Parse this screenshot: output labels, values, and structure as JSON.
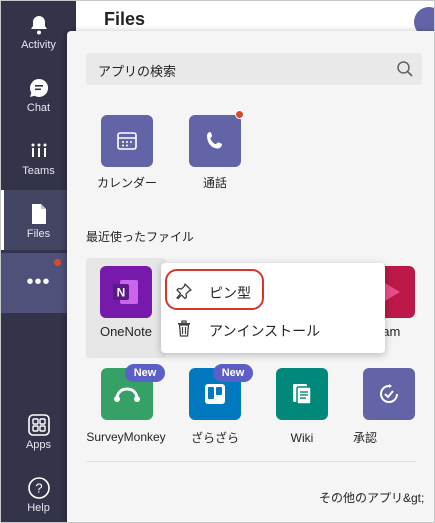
{
  "header": {
    "title": "Files"
  },
  "rail": {
    "items": [
      {
        "label": "Activity",
        "icon": "bell-icon"
      },
      {
        "label": "Chat",
        "icon": "chat-icon"
      },
      {
        "label": "Teams",
        "icon": "teams-icon"
      },
      {
        "label": "Files",
        "icon": "file-icon",
        "active": true
      },
      {
        "label": "",
        "icon": "more-icon"
      },
      {
        "label": "Apps",
        "icon": "apps-icon"
      },
      {
        "label": "Help",
        "icon": "help-icon"
      }
    ],
    "more_symbol": "•••"
  },
  "flyout": {
    "search_placeholder": "アプリの検索",
    "pinned_apps": [
      {
        "label": "カレンダー",
        "icon": "calendar-icon",
        "color": "#6264a7"
      },
      {
        "label": "通話",
        "icon": "phone-icon",
        "color": "#6264a7",
        "notification": true
      }
    ],
    "recent_title": "最近使ったファイル",
    "recent_apps": [
      {
        "label": "OneNote",
        "icon": "onenote-icon",
        "color": "#7719aa"
      },
      {
        "label": "eam",
        "icon": "stream-icon",
        "color": "#bc1948"
      }
    ],
    "more_apps": [
      {
        "label": "SurveyMonkey",
        "icon": "surveymonkey-icon",
        "color": "#36a167",
        "badge": "New"
      },
      {
        "label": "ざらざら",
        "icon": "trello-icon",
        "color": "#0079bf",
        "badge": "New"
      },
      {
        "label": "Wiki",
        "icon": "wiki-icon",
        "color": "#00897b"
      },
      {
        "label": "承認",
        "icon": "approvals-icon",
        "color": "#6264a7"
      }
    ],
    "more_apps_link": "その他のアプリ&gt;"
  },
  "context_menu": {
    "items": [
      {
        "label": "ピン型",
        "icon": "pin-icon"
      },
      {
        "label": "アンインストール",
        "icon": "trash-icon"
      }
    ]
  }
}
